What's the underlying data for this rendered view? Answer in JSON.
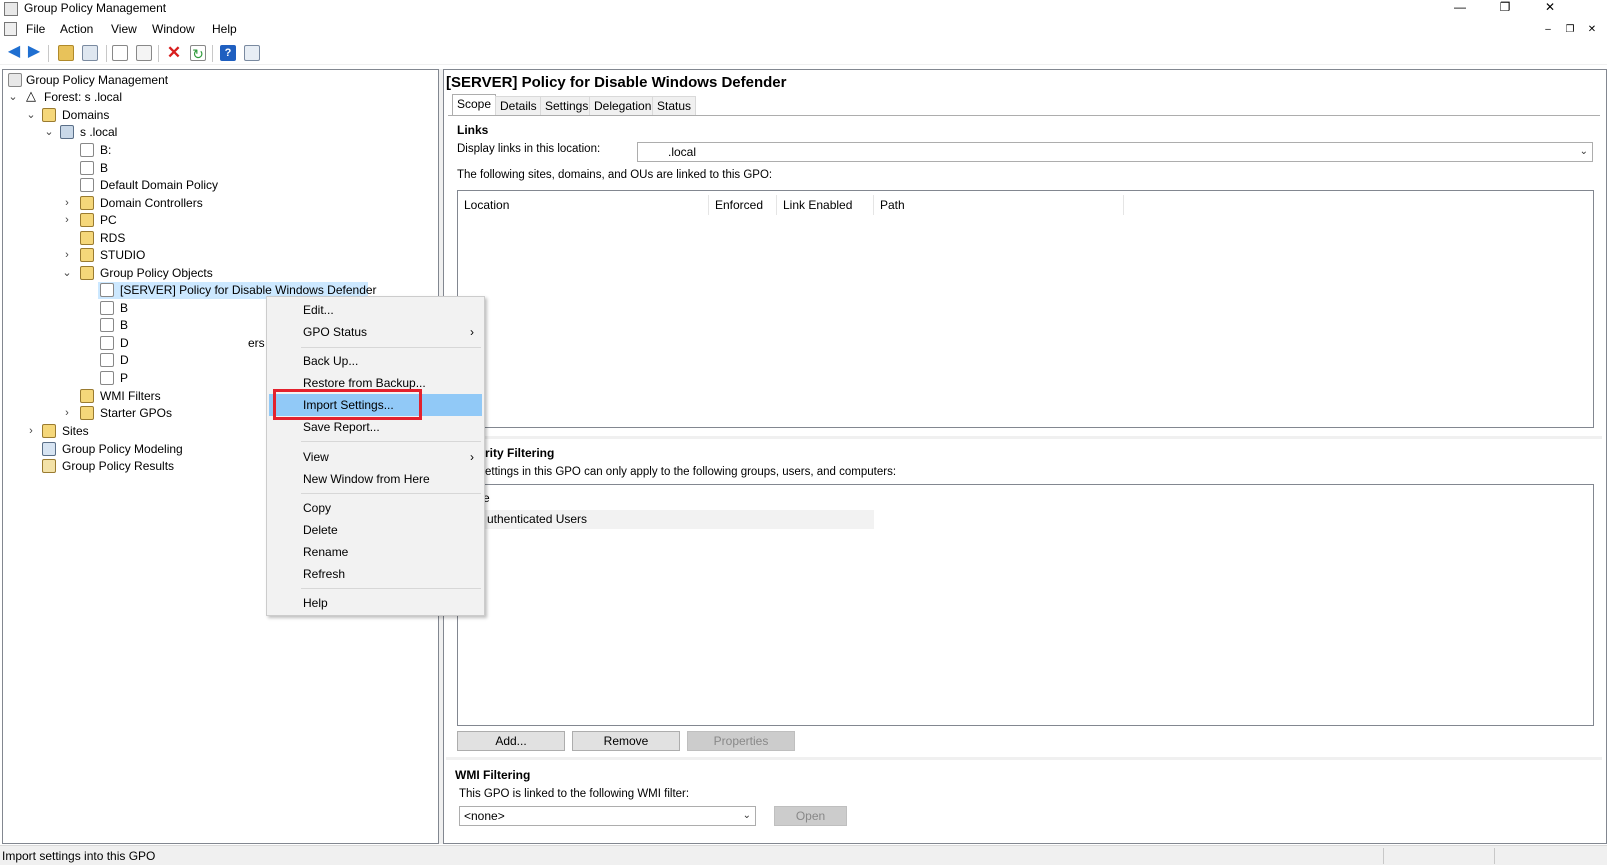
{
  "window": {
    "title": "Group Policy Management",
    "controls": {
      "minimize": "—",
      "restore": "❐",
      "close": "✕"
    },
    "mdi_controls": {
      "minimize": "–",
      "restore": "❐",
      "close": "✕"
    }
  },
  "menu": [
    "File",
    "Action",
    "View",
    "Window",
    "Help"
  ],
  "toolbar_icons": [
    "back-icon",
    "forward-icon",
    "up-folder-icon",
    "show-hide-tree-icon",
    "copy-icon",
    "paste-icon",
    "delete-icon",
    "refresh-icon",
    "help-icon",
    "properties-icon"
  ],
  "tree": {
    "root": "Group Policy Management",
    "forest": "Forest: s          .local",
    "domains": "Domains",
    "domain": "s          .local",
    "items": {
      "b1": "B:",
      "b2": "B",
      "default_domain_policy": "Default Domain Policy",
      "domain_controllers": "Domain Controllers",
      "pc": "PC",
      "rds": "RDS",
      "studio": "STUDIO",
      "gpo": "Group Policy Objects",
      "gpo_selected": "[SERVER] Policy for Disable Windows Defender",
      "gpo2": "B",
      "gpo3": "B",
      "gpo4": "D",
      "gpo4_tail": "ers",
      "gpo5": "D",
      "gpo6": "P",
      "wmi": "WMI Filters",
      "starter": "Starter GPOs",
      "sites": "Sites",
      "modeling": "Group Policy Modeling",
      "results": "Group Policy Results"
    }
  },
  "details": {
    "title": "[SERVER] Policy for Disable Windows Defender",
    "tabs": [
      "Scope",
      "Details",
      "Settings",
      "Delegation",
      "Status"
    ],
    "active_tab": "Scope",
    "links": {
      "heading": "Links",
      "display_label": "Display links in this location:",
      "location_value": ".local",
      "linked_label": "The following sites, domains, and OUs are linked to this GPO:",
      "columns": [
        "Location",
        "Enforced",
        "Link Enabled",
        "Path"
      ]
    },
    "security": {
      "heading": "rity Filtering",
      "desc": "ettings in this GPO can only apply to the following groups, users, and computers:",
      "column": "e",
      "rows": [
        "uthenticated Users"
      ],
      "buttons": {
        "add": "Add...",
        "remove": "Remove",
        "properties": "Properties"
      }
    },
    "wmi": {
      "heading": "WMI Filtering",
      "desc": "This GPO is linked to the following WMI filter:",
      "value": "<none>",
      "open": "Open"
    }
  },
  "context_menu": {
    "items": [
      {
        "label": "Edit..."
      },
      {
        "label": "GPO Status",
        "submenu": "›"
      },
      {
        "label": "Back Up..."
      },
      {
        "label": "Restore from Backup..."
      },
      {
        "label": "Import Settings..."
      },
      {
        "label": "Save Report..."
      },
      {
        "label": "View",
        "submenu": "›"
      },
      {
        "label": "New Window from Here"
      },
      {
        "label": "Copy"
      },
      {
        "label": "Delete"
      },
      {
        "label": "Rename"
      },
      {
        "label": "Refresh"
      },
      {
        "label": "Help"
      }
    ],
    "highlighted": "Import Settings..."
  },
  "status": {
    "text": "Import settings into this GPO"
  },
  "colors": {
    "highlight": "#91c9f7",
    "annotation": "#e3212d",
    "selection": "#cce8ff"
  }
}
